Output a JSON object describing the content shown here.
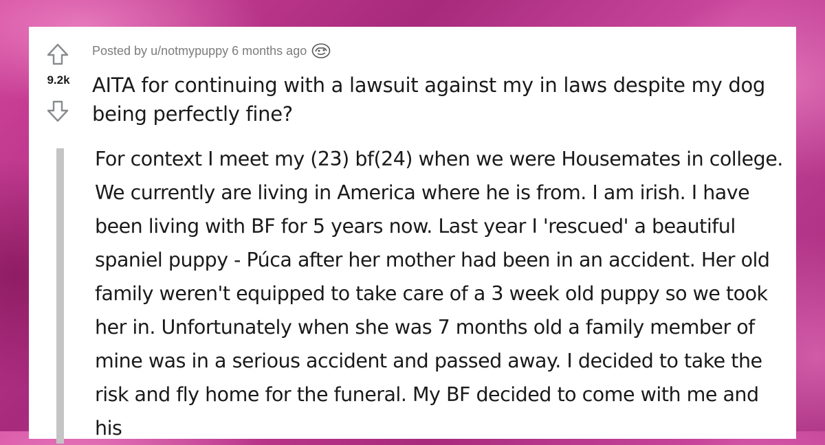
{
  "post": {
    "score": "9.2k",
    "posted_by_prefix": "Posted by",
    "author": "u/notmypuppy",
    "time_ago": "6 months ago",
    "award_icon": "award-icon",
    "title": "AITA for continuing with a lawsuit against my in laws despite my dog being perfectly fine?",
    "body": "For context I meet my (23) bf(24) when we were Housemates in college. We currently are living in America where he is from. I am irish. I have been living with BF for 5 years now. Last year I 'rescued' a beautiful spaniel puppy - Púca after her mother had been in an accident. Her old family weren't equipped to take care of a 3 week old puppy so we took her in. Unfortunately when she was 7 months old a family member of mine was in a serious accident and passed away. I decided to take the risk and fly home for the funeral. My BF decided to come with me and his"
  },
  "colors": {
    "text": "#1a1a1b",
    "meta": "#7c7c7c",
    "quote_bar": "#c4c4c4",
    "card": "#ffffff",
    "background": "#c23f93"
  },
  "icons": {
    "upvote": "upvote-arrow-icon",
    "downvote": "downvote-arrow-icon"
  }
}
